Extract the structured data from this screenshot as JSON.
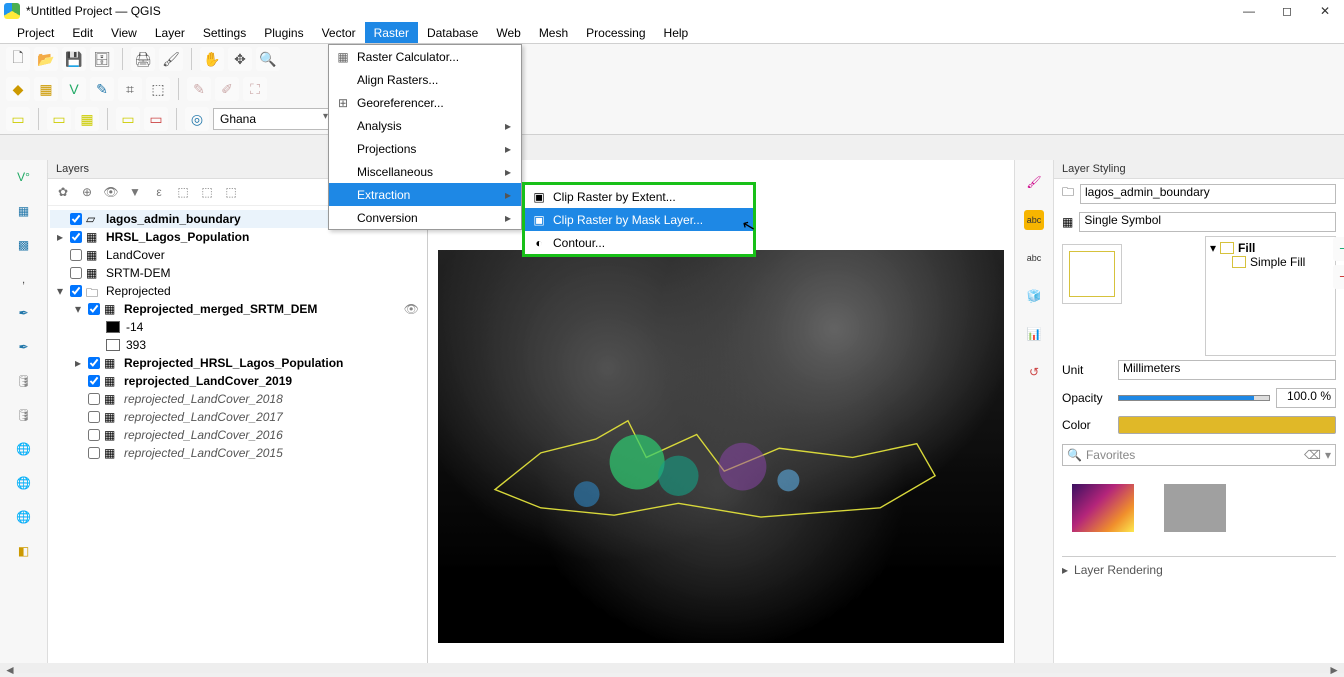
{
  "title": "*Untitled Project — QGIS",
  "menus": [
    "Project",
    "Edit",
    "View",
    "Layer",
    "Settings",
    "Plugins",
    "Vector",
    "Raster",
    "Database",
    "Web",
    "Mesh",
    "Processing",
    "Help"
  ],
  "active_menu_index": 7,
  "location_combo": "Ghana",
  "raster_menu": {
    "items": [
      {
        "label": "Raster Calculator...",
        "icon": "▦"
      },
      {
        "label": "Align Rasters...",
        "icon": ""
      },
      {
        "label": "Georeferencer...",
        "icon": "⊞"
      },
      {
        "label": "Analysis",
        "sub": true
      },
      {
        "label": "Projections",
        "sub": true
      },
      {
        "label": "Miscellaneous",
        "sub": true
      },
      {
        "label": "Extraction",
        "sub": true,
        "hi": true
      },
      {
        "label": "Conversion",
        "sub": true
      }
    ],
    "extraction_sub": [
      {
        "label": "Clip Raster by Extent...",
        "icon": "▣"
      },
      {
        "label": "Clip Raster by Mask Layer...",
        "icon": "▣",
        "hi": true
      },
      {
        "label": "Contour...",
        "icon": "◐"
      }
    ]
  },
  "layers_panel": {
    "title": "Layers",
    "tree": [
      {
        "d": 0,
        "chk": true,
        "tw": "",
        "icon": "poly",
        "label": "lagos_admin_boundary",
        "bold": true,
        "sel": true,
        "eye": true
      },
      {
        "d": 0,
        "chk": true,
        "tw": "▸",
        "icon": "rast",
        "label": "HRSL_Lagos_Population",
        "bold": true
      },
      {
        "d": 0,
        "chk": false,
        "tw": "",
        "icon": "rast",
        "label": "LandCover"
      },
      {
        "d": 0,
        "chk": false,
        "tw": "",
        "icon": "rast",
        "label": "SRTM-DEM"
      },
      {
        "d": 0,
        "chk": true,
        "tw": "▾",
        "icon": "grp",
        "label": "Reprojected"
      },
      {
        "d": 1,
        "chk": true,
        "tw": "▾",
        "icon": "rast",
        "label": "Reprojected_merged_SRTM_DEM",
        "bold": true,
        "eye": true
      },
      {
        "d": 2,
        "swatch": "#000",
        "label": "-14"
      },
      {
        "d": 2,
        "swatch": "",
        "label": "393"
      },
      {
        "d": 1,
        "chk": true,
        "tw": "▸",
        "icon": "rast",
        "label": "Reprojected_HRSL_Lagos_Population",
        "bold": true
      },
      {
        "d": 1,
        "chk": true,
        "tw": "",
        "icon": "rast",
        "label": "reprojected_LandCover_2019",
        "bold": true
      },
      {
        "d": 1,
        "chk": false,
        "tw": "",
        "icon": "rast",
        "label": "reprojected_LandCover_2018",
        "italic": true
      },
      {
        "d": 1,
        "chk": false,
        "tw": "",
        "icon": "rast",
        "label": "reprojected_LandCover_2017",
        "italic": true
      },
      {
        "d": 1,
        "chk": false,
        "tw": "",
        "icon": "rast",
        "label": "reprojected_LandCover_2016",
        "italic": true
      },
      {
        "d": 1,
        "chk": false,
        "tw": "",
        "icon": "rast",
        "label": "reprojected_LandCover_2015",
        "italic": true
      }
    ]
  },
  "styling_panel": {
    "title": "Layer Styling",
    "layer_select": "lagos_admin_boundary",
    "symbol_select": "Single Symbol",
    "fill_header": "Fill",
    "fill_child": "Simple Fill",
    "unit_label": "Unit",
    "unit_value": "Millimeters",
    "opacity_label": "Opacity",
    "opacity_value": "100.0 %",
    "color_label": "Color",
    "favorites_placeholder": "Favorites",
    "footer": "Layer Rendering"
  }
}
